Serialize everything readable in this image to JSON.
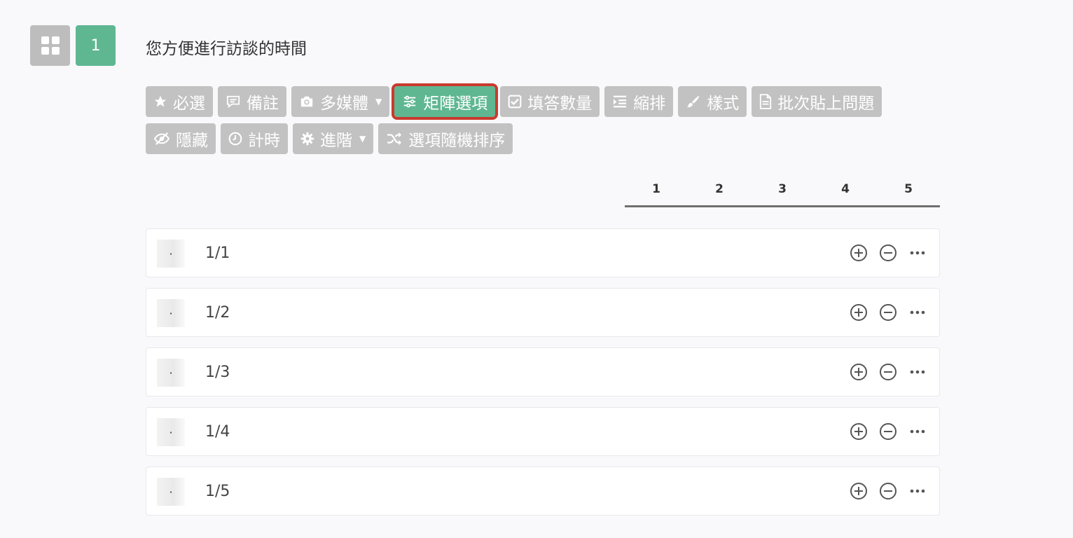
{
  "question": {
    "type_icon": "grid-icon",
    "number": "1",
    "title": "您方便進行訪談的時間"
  },
  "toolbar": {
    "row1": [
      {
        "label": "必選",
        "icon": "star-icon"
      },
      {
        "label": "備註",
        "icon": "comment-icon"
      },
      {
        "label": "多媒體",
        "icon": "camera-icon",
        "dropdown": true
      },
      {
        "label": "矩陣選項",
        "icon": "sliders-icon",
        "active": true
      },
      {
        "label": "填答數量",
        "icon": "checkbox-icon"
      },
      {
        "label": "縮排",
        "icon": "indent-icon"
      },
      {
        "label": "樣式",
        "icon": "paintbrush-icon"
      },
      {
        "label": "批次貼上問題",
        "icon": "document-icon"
      }
    ],
    "row2": [
      {
        "label": "隱藏",
        "icon": "eye-slash-icon"
      },
      {
        "label": "計時",
        "icon": "clock-icon"
      },
      {
        "label": "進階",
        "icon": "gear-icon",
        "dropdown": true
      },
      {
        "label": "選項隨機排序",
        "icon": "shuffle-icon"
      }
    ]
  },
  "scale": [
    "1",
    "2",
    "3",
    "4",
    "5"
  ],
  "rows": [
    {
      "label": "1/1",
      "handle": "·"
    },
    {
      "label": "1/2",
      "handle": "·"
    },
    {
      "label": "1/3",
      "handle": "·"
    },
    {
      "label": "1/4",
      "handle": "·"
    },
    {
      "label": "1/5",
      "handle": "·"
    }
  ],
  "colors": {
    "accent": "#5fb792",
    "button_gray": "#c2c2c2",
    "highlight_border": "#c93a2e"
  }
}
